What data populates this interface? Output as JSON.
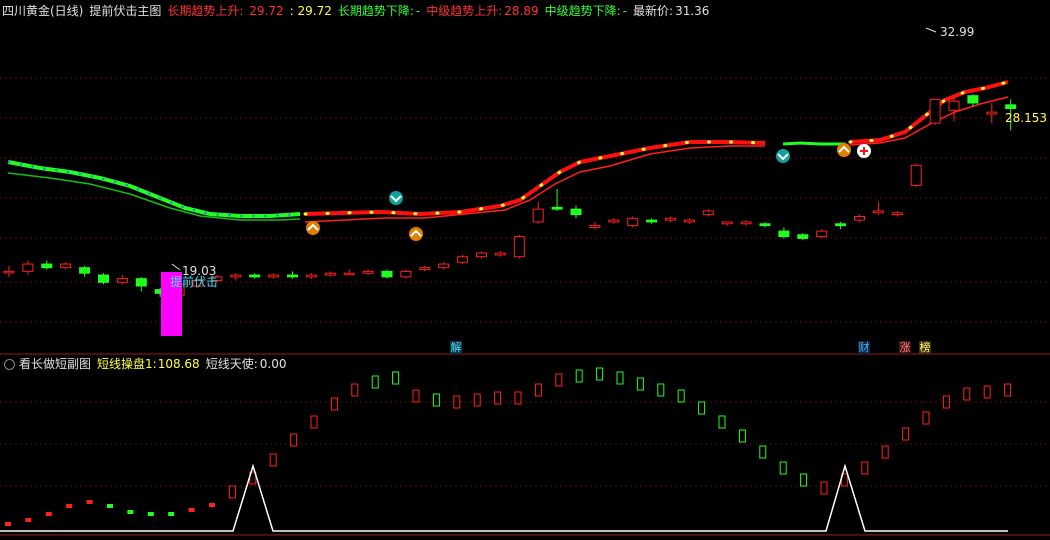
{
  "main_header": {
    "symbol": "四川黄金(日线)",
    "indicator": "提前伏击主图",
    "long_up_label": "长期趋势上升:",
    "long_up_value": "29.72",
    "long_up_value2": ": 29.72",
    "long_down_label": "长期趋势下降:",
    "long_down_value": "-",
    "mid_up_label": "中级趋势上升:",
    "mid_up_value": "28.89",
    "mid_down_label": "中级趋势下降:",
    "mid_down_value": "-",
    "latest_label": "最新价:",
    "latest_value": "31.36"
  },
  "sub_header": {
    "indicator": "看长做短副图",
    "op_label": "短线操盘1:",
    "op_value": "108.68",
    "angel_label": "短线天使:",
    "angel_value": "0.00"
  },
  "annotations": {
    "high": "32.99",
    "low": "19.03",
    "right_price": "28.153",
    "signal_text": "提前伏击"
  },
  "badges": [
    "解",
    "财",
    "涨",
    "榜"
  ],
  "colors": {
    "up": "#ff2020",
    "down": "#20ff20",
    "magenta": "#ff00ff",
    "cyan": "#40e0ff",
    "yellow": "#ffff40"
  },
  "chart_data": {
    "type": "candlestick",
    "candles": [
      [
        19.8,
        19.8,
        20.1,
        19.5
      ],
      [
        19.8,
        20.2,
        20.4,
        19.6
      ],
      [
        20.2,
        20.0,
        20.4,
        19.9
      ],
      [
        20.0,
        20.2,
        20.3,
        19.9
      ],
      [
        20.0,
        19.7,
        20.1,
        19.5
      ],
      [
        19.6,
        19.2,
        19.7,
        19.1
      ],
      [
        19.2,
        19.4,
        19.6,
        19.1
      ],
      [
        19.4,
        19.0,
        19.5,
        18.7
      ],
      [
        18.8,
        18.6,
        18.9,
        18.4
      ],
      [
        18.5,
        19.1,
        19.2,
        18.4
      ],
      [
        19.0,
        19.3,
        19.4,
        18.9
      ],
      [
        19.3,
        19.5,
        19.6,
        19.2
      ],
      [
        19.5,
        19.6,
        19.7,
        19.3
      ],
      [
        19.6,
        19.5,
        19.7,
        19.4
      ],
      [
        19.5,
        19.6,
        19.7,
        19.4
      ],
      [
        19.6,
        19.5,
        19.8,
        19.4
      ],
      [
        19.5,
        19.6,
        19.7,
        19.4
      ],
      [
        19.6,
        19.7,
        19.8,
        19.5
      ],
      [
        19.7,
        19.7,
        19.9,
        19.6
      ],
      [
        19.7,
        19.8,
        19.9,
        19.6
      ],
      [
        19.8,
        19.5,
        19.9,
        19.4
      ],
      [
        19.5,
        19.8,
        19.9,
        19.4
      ],
      [
        19.9,
        20.0,
        20.1,
        19.8
      ],
      [
        20.0,
        20.2,
        20.3,
        19.9
      ],
      [
        20.3,
        20.6,
        20.7,
        20.2
      ],
      [
        20.6,
        20.8,
        20.9,
        20.5
      ],
      [
        20.7,
        20.8,
        20.9,
        20.6
      ],
      [
        20.6,
        21.7,
        21.8,
        20.5
      ],
      [
        22.5,
        23.2,
        23.6,
        22.4
      ],
      [
        23.3,
        23.2,
        24.3,
        23.1
      ],
      [
        23.2,
        22.9,
        23.4,
        22.7
      ],
      [
        22.2,
        22.3,
        22.5,
        22.1
      ],
      [
        22.5,
        22.6,
        22.7,
        22.4
      ],
      [
        22.3,
        22.7,
        22.8,
        22.2
      ],
      [
        22.6,
        22.5,
        22.7,
        22.4
      ],
      [
        22.6,
        22.7,
        22.8,
        22.5
      ],
      [
        22.5,
        22.6,
        22.7,
        22.4
      ],
      [
        22.9,
        23.1,
        23.2,
        22.8
      ],
      [
        22.4,
        22.5,
        22.5,
        22.3
      ],
      [
        22.4,
        22.5,
        22.6,
        22.3
      ],
      [
        22.4,
        22.3,
        22.5,
        22.2
      ],
      [
        22.0,
        21.7,
        22.2,
        21.6
      ],
      [
        21.8,
        21.6,
        21.9,
        21.5
      ],
      [
        21.7,
        22.0,
        22.1,
        21.6
      ],
      [
        22.4,
        22.3,
        22.5,
        22.1
      ],
      [
        22.6,
        22.8,
        22.9,
        22.5
      ],
      [
        23.0,
        23.1,
        23.6,
        22.9
      ],
      [
        22.9,
        23.0,
        23.1,
        22.8
      ],
      [
        24.5,
        25.6,
        25.7,
        24.4
      ],
      [
        27.9,
        29.2,
        29.2,
        27.8
      ],
      [
        28.6,
        29.1,
        29.3,
        28.0
      ],
      [
        29.4,
        29.0,
        29.5,
        28.8
      ],
      [
        28.4,
        28.5,
        29.0,
        27.9
      ],
      [
        28.9,
        28.7,
        29.2,
        27.5
      ]
    ]
  }
}
